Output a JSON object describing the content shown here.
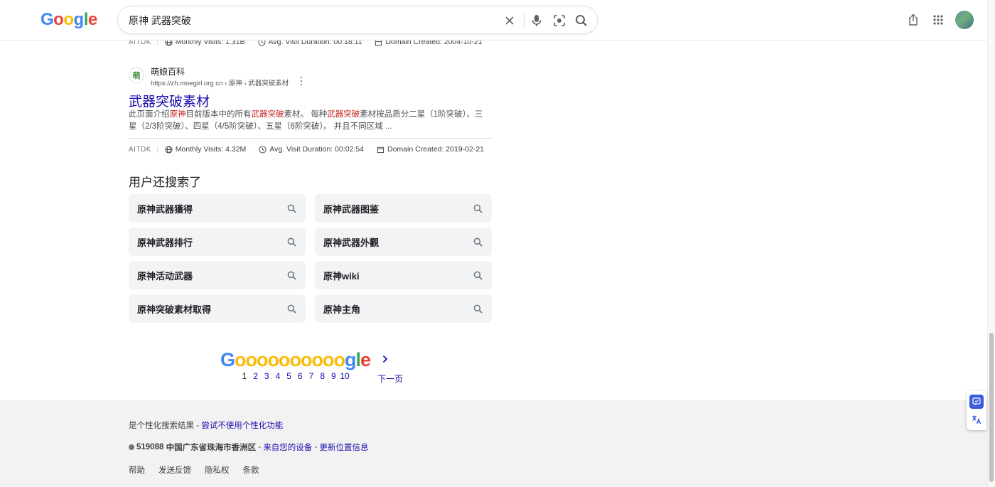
{
  "header": {
    "logo": [
      "G",
      "o",
      "o",
      "g",
      "l",
      "e"
    ],
    "search_value": "原神 武器突破"
  },
  "top_metrics": {
    "aitdk": "AITDK",
    "monthly_visits": "Monthly Visits: 1.31B",
    "avg_duration": "Avg. Visit Duration: 00:18:11",
    "domain_created": "Domain Created: 2004-10-21"
  },
  "result": {
    "favicon_char": "萌",
    "site_name": "萌娘百科",
    "url": "https://zh.moegirl.org.cn › 原神 › 武器突破素材",
    "title": "武器突破素材",
    "snippet": {
      "p1": "此页面介绍",
      "h1": "原神",
      "p2": "目前版本中的所有",
      "h2": "武器突破",
      "p3": "素材。 每种",
      "h3": "武器突破",
      "p4": "素材按品质分二星（1阶突破）、三星（2/3阶突破）、四星（4/5阶突破）、五星（6阶突破）。 并且不同区域 ..."
    }
  },
  "result_metrics": {
    "aitdk": "AITDK",
    "monthly_visits": "Monthly Visits: 4.32M",
    "avg_duration": "Avg. Visit Duration: 00:02:54",
    "domain_created": "Domain Created: 2019-02-21"
  },
  "related": {
    "heading": "用户还搜索了",
    "items": [
      "原神武器獲得",
      "原神武器图鉴",
      "原神武器排行",
      "原神武器外觀",
      "原神活动武器",
      "原神wiki",
      "原神突破素材取得",
      "原神主角"
    ]
  },
  "pagination": {
    "logo_letters": [
      "G",
      "o",
      "o",
      "o",
      "o",
      "o",
      "o",
      "o",
      "o",
      "o",
      "o",
      "g",
      "l",
      "e"
    ],
    "pages": [
      "1",
      "2",
      "3",
      "4",
      "5",
      "6",
      "7",
      "8",
      "9",
      "10"
    ],
    "current": "1",
    "next_label": "下一页"
  },
  "footer": {
    "personalized_text": "是个性化搜索结果 - ",
    "personalized_link": "尝试不使用个性化功能",
    "location_code": "519088",
    "location_text": "中国广东省珠海市香洲区",
    "location_sep1": " - ",
    "location_link1": "来自您的设备",
    "location_sep2": " - ",
    "location_link2": "更新位置信息",
    "links": [
      "帮助",
      "发送反馈",
      "隐私权",
      "条款"
    ]
  },
  "colors": {
    "google_blue": "#4285F4",
    "google_red": "#EA4335",
    "google_yellow": "#FBBC05",
    "google_green": "#34A853",
    "link_blue": "#1a0dab",
    "highlight_red": "#c5221f"
  }
}
